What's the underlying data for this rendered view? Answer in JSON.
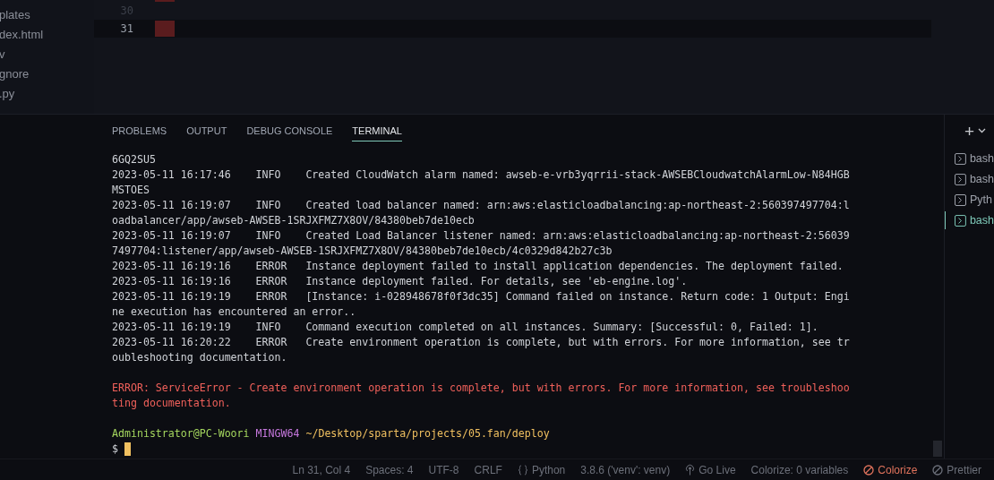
{
  "sidebar": {
    "items": [
      "plates",
      "dex.html",
      "v",
      "gnore",
      ".py"
    ]
  },
  "editor": {
    "lines": [
      {
        "number": "30",
        "current": false
      },
      {
        "number": "31",
        "current": true
      }
    ]
  },
  "panel": {
    "tabs": [
      {
        "label": "PROBLEMS",
        "selected": false
      },
      {
        "label": "OUTPUT",
        "selected": false
      },
      {
        "label": "DEBUG CONSOLE",
        "selected": false
      },
      {
        "label": "TERMINAL",
        "selected": true
      }
    ],
    "add_button": "+"
  },
  "terminal": {
    "lines": [
      {
        "kind": "text",
        "text": "6GQ2SU5"
      },
      {
        "kind": "text",
        "text": "2023-05-11 16:17:46    INFO    Created CloudWatch alarm named: awseb-e-vrb3yqrrii-stack-AWSEBCloudwatchAlarmLow-N84HGB"
      },
      {
        "kind": "text",
        "text": "MSTOES"
      },
      {
        "kind": "text",
        "text": "2023-05-11 16:19:07    INFO    Created load balancer named: arn:aws:elasticloadbalancing:ap-northeast-2:560397497704:l"
      },
      {
        "kind": "text",
        "text": "oadbalancer/app/awseb-AWSEB-1SRJXFMZ7X8OV/84380beb7de10ecb"
      },
      {
        "kind": "text",
        "text": "2023-05-11 16:19:07    INFO    Created Load Balancer listener named: arn:aws:elasticloadbalancing:ap-northeast-2:56039"
      },
      {
        "kind": "text",
        "text": "7497704:listener/app/awseb-AWSEB-1SRJXFMZ7X8OV/84380beb7de10ecb/4c0329d842b27c3b"
      },
      {
        "kind": "text",
        "text": "2023-05-11 16:19:16    ERROR   Instance deployment failed to install application dependencies. The deployment failed."
      },
      {
        "kind": "text",
        "text": "2023-05-11 16:19:16    ERROR   Instance deployment failed. For details, see 'eb-engine.log'."
      },
      {
        "kind": "text",
        "text": "2023-05-11 16:19:19    ERROR   [Instance: i-028948678f0f3dc35] Command failed on instance. Return code: 1 Output: Engi"
      },
      {
        "kind": "text",
        "text": "ne execution has encountered an error.."
      },
      {
        "kind": "text",
        "text": "2023-05-11 16:19:19    INFO    Command execution completed on all instances. Summary: [Successful: 0, Failed: 1]."
      },
      {
        "kind": "text",
        "text": "2023-05-11 16:20:22    ERROR   Create environment operation is complete, but with errors. For more information, see tr"
      },
      {
        "kind": "text",
        "text": "oubleshooting documentation."
      },
      {
        "kind": "blank"
      },
      {
        "kind": "error",
        "text": "ERROR: ServiceError - Create environment operation is complete, but with errors. For more information, see troubleshoo"
      },
      {
        "kind": "error",
        "text": "ting documentation."
      },
      {
        "kind": "blank"
      },
      {
        "kind": "prompt",
        "user": "Administrator@PC-Woori",
        "system": "MINGW64",
        "path": "~/Desktop/sparta/projects/05.fan/deploy"
      },
      {
        "kind": "input",
        "text": "$"
      }
    ]
  },
  "terminal_list": [
    {
      "label": "bash",
      "selected": false
    },
    {
      "label": "bash",
      "selected": false
    },
    {
      "label": "Pyth",
      "selected": false
    },
    {
      "label": "bash",
      "selected": true
    }
  ],
  "status_bar": [
    {
      "kind": "plain",
      "text": "Ln 31, Col 4"
    },
    {
      "kind": "plain",
      "text": "Spaces: 4"
    },
    {
      "kind": "plain",
      "text": "UTF-8"
    },
    {
      "kind": "plain",
      "text": "CRLF"
    },
    {
      "kind": "language",
      "text": "Python"
    },
    {
      "kind": "plain",
      "text": "3.8.6 ('venv': venv)"
    },
    {
      "kind": "live",
      "text": "Go Live"
    },
    {
      "kind": "plain",
      "text": "Colorize: 0 variables"
    },
    {
      "kind": "alert",
      "text": "Colorize"
    },
    {
      "kind": "disabled",
      "text": "Prettier"
    }
  ]
}
